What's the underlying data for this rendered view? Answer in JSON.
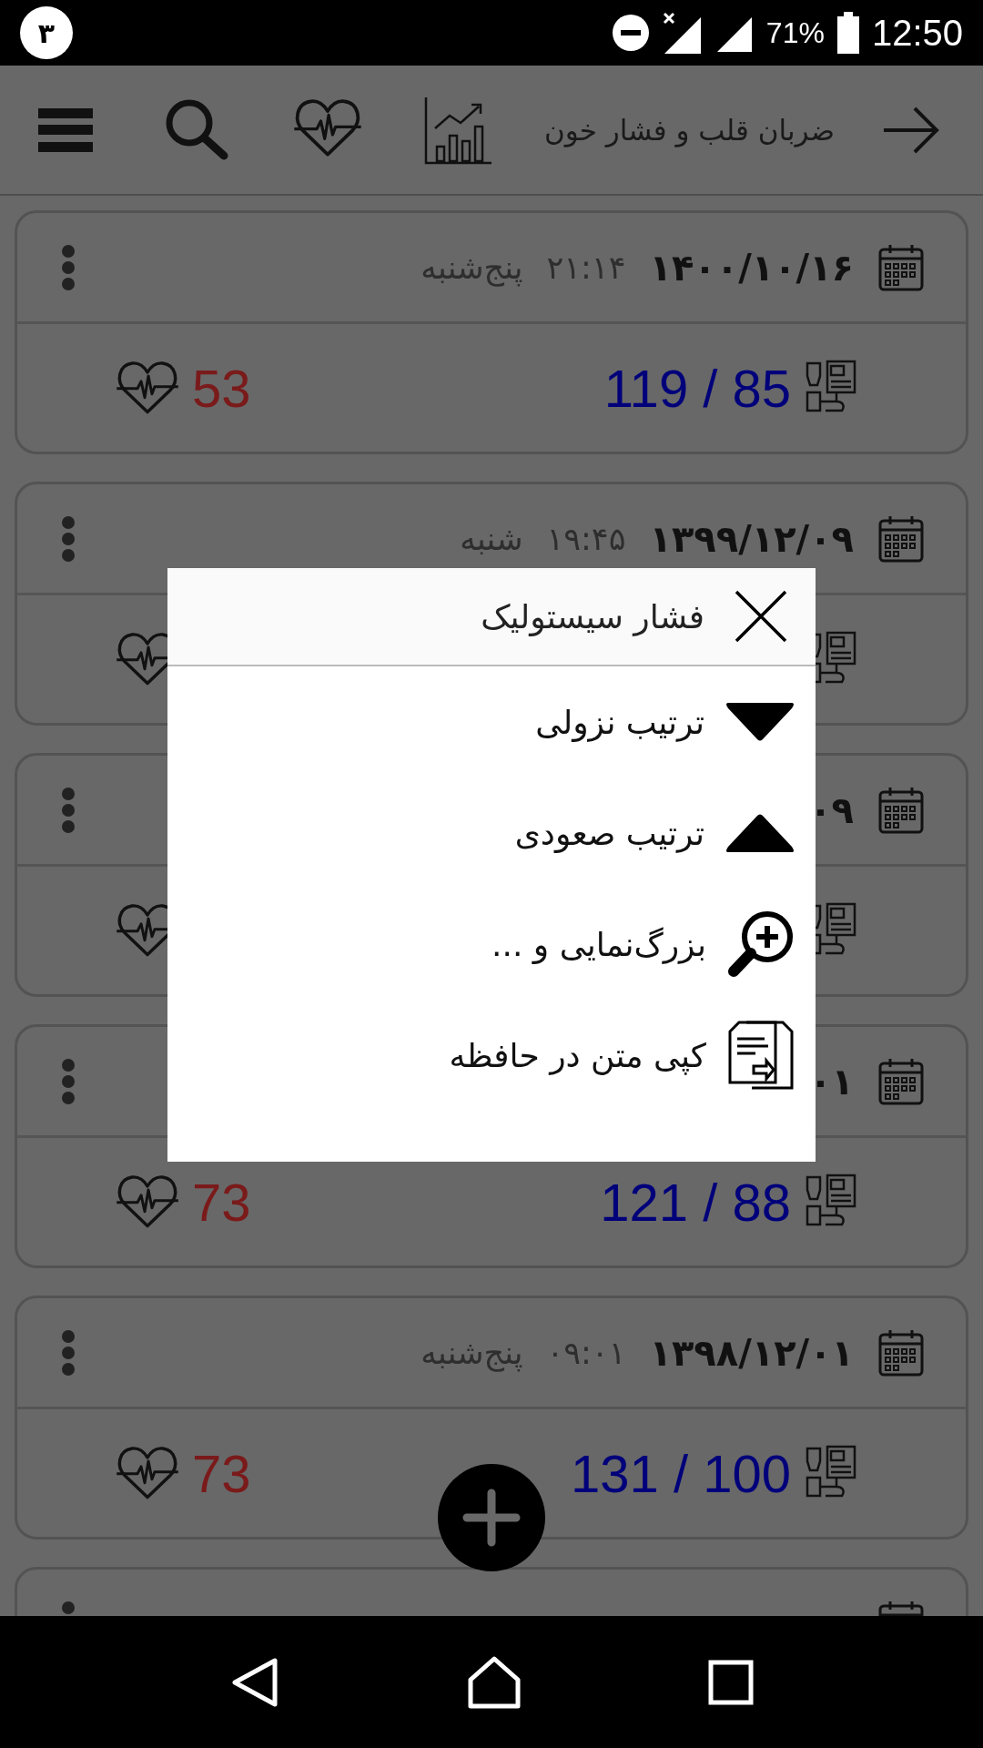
{
  "status_bar": {
    "notification_badge": "٣",
    "battery_percent": "71%",
    "time": "12:50"
  },
  "app_bar": {
    "title": "ضربان قلب و فشار خون"
  },
  "records": [
    {
      "date": "۱۴۰۰/۱۰/۱۶",
      "time": "۲۱:۱۴",
      "weekday": "پنج‌شنبه",
      "pressure": "119 / 85",
      "pulse": "53"
    },
    {
      "date": "۱۳۹۹/۱۲/۰۹",
      "time": "۱۹:۴۵",
      "weekday": "شنبه"
    },
    {
      "date": "۰۹"
    },
    {
      "date": "۰۱",
      "pressure": "121 / 88",
      "pulse": "73"
    },
    {
      "date": "۱۳۹۸/۱۲/۰۱",
      "time": "۰۹:۰۱",
      "weekday": "پنج‌شنبه",
      "pressure": "131 / 100",
      "pulse": "73"
    }
  ],
  "dialog": {
    "title": "فشار سیستولیک",
    "items": [
      {
        "kind": "descending",
        "label": "ترتیب نزولی"
      },
      {
        "kind": "ascending",
        "label": "ترتیب صعودی"
      },
      {
        "kind": "zoom",
        "label": "بزرگ‌نمایی و ..."
      },
      {
        "kind": "copy",
        "label": "کپی متن در حافظه"
      }
    ]
  }
}
